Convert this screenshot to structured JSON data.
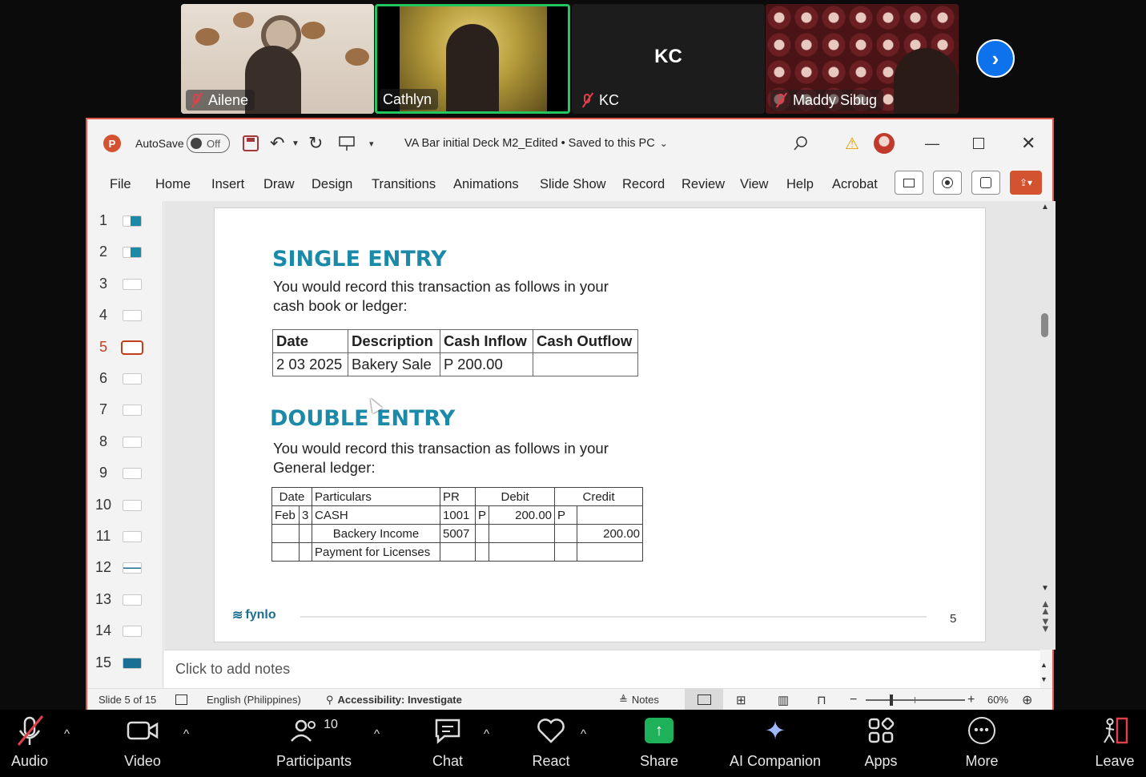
{
  "participants": [
    {
      "name": "Ailene",
      "muted": true
    },
    {
      "name": "Cathlyn",
      "muted": false,
      "active_speaker": true
    },
    {
      "name": "KC",
      "initials": "KC",
      "muted": true
    },
    {
      "name": "Maddy Sibug",
      "muted": true
    }
  ],
  "ppt": {
    "autosave_label": "AutoSave",
    "autosave_state": "Off",
    "doc_title": "VA Bar initial Deck M2_Edited • Saved to this PC",
    "ribbon_tabs": [
      "File",
      "Home",
      "Insert",
      "Draw",
      "Design",
      "Transitions",
      "Animations",
      "Slide Show",
      "Record",
      "Review",
      "View",
      "Help",
      "Acrobat"
    ],
    "thumb_numbers": [
      "1",
      "2",
      "3",
      "4",
      "5",
      "6",
      "7",
      "8",
      "9",
      "10",
      "11",
      "12",
      "13",
      "14",
      "15"
    ],
    "selected_slide": "5",
    "notes_placeholder": "Click to add notes",
    "status": {
      "slide_of": "Slide 5 of 15",
      "language": "English (Philippines)",
      "accessibility": "Accessibility: Investigate",
      "notes": "Notes",
      "zoom": "60%"
    }
  },
  "slide": {
    "single_heading": "SINGLE ENTRY",
    "single_text_1": "You would record this transaction as follows in your",
    "single_text_2": "cash book or ledger:",
    "single_table": {
      "headers": [
        "Date",
        "Description",
        "Cash Inflow",
        "Cash Outflow"
      ],
      "row": [
        "2 03 2025",
        "Bakery Sale",
        "P 200.00",
        ""
      ]
    },
    "double_heading": "DOUBLE ENTRY",
    "double_text_1": "You would record this transaction as follows in your",
    "double_text_2": "General ledger:",
    "double_table": {
      "headers": [
        "Date",
        "Particulars",
        "PR",
        "Debit",
        "Credit"
      ],
      "rows": [
        [
          "Feb",
          "3",
          "CASH",
          "1001",
          "P",
          "200.00",
          "P",
          ""
        ],
        [
          "",
          "",
          "Backery Income",
          "5007",
          "",
          "",
          "",
          "200.00"
        ],
        [
          "",
          "",
          "Payment for Licenses",
          "",
          "",
          "",
          "",
          ""
        ]
      ]
    },
    "footer_logo": "fynlo",
    "page_number": "5"
  },
  "toolbar": {
    "audio": "Audio",
    "video": "Video",
    "participants": "Participants",
    "participants_count": "10",
    "chat": "Chat",
    "react": "React",
    "share": "Share",
    "ai_companion": "AI Companion",
    "apps": "Apps",
    "more": "More",
    "leave": "Leave"
  },
  "colors": {
    "heading_teal": "#1a8aa8",
    "window_border": "#e0594b",
    "share_green": "#1fb15a",
    "active_speaker": "#22c55e",
    "zoom_blue": "#0e72ed"
  }
}
